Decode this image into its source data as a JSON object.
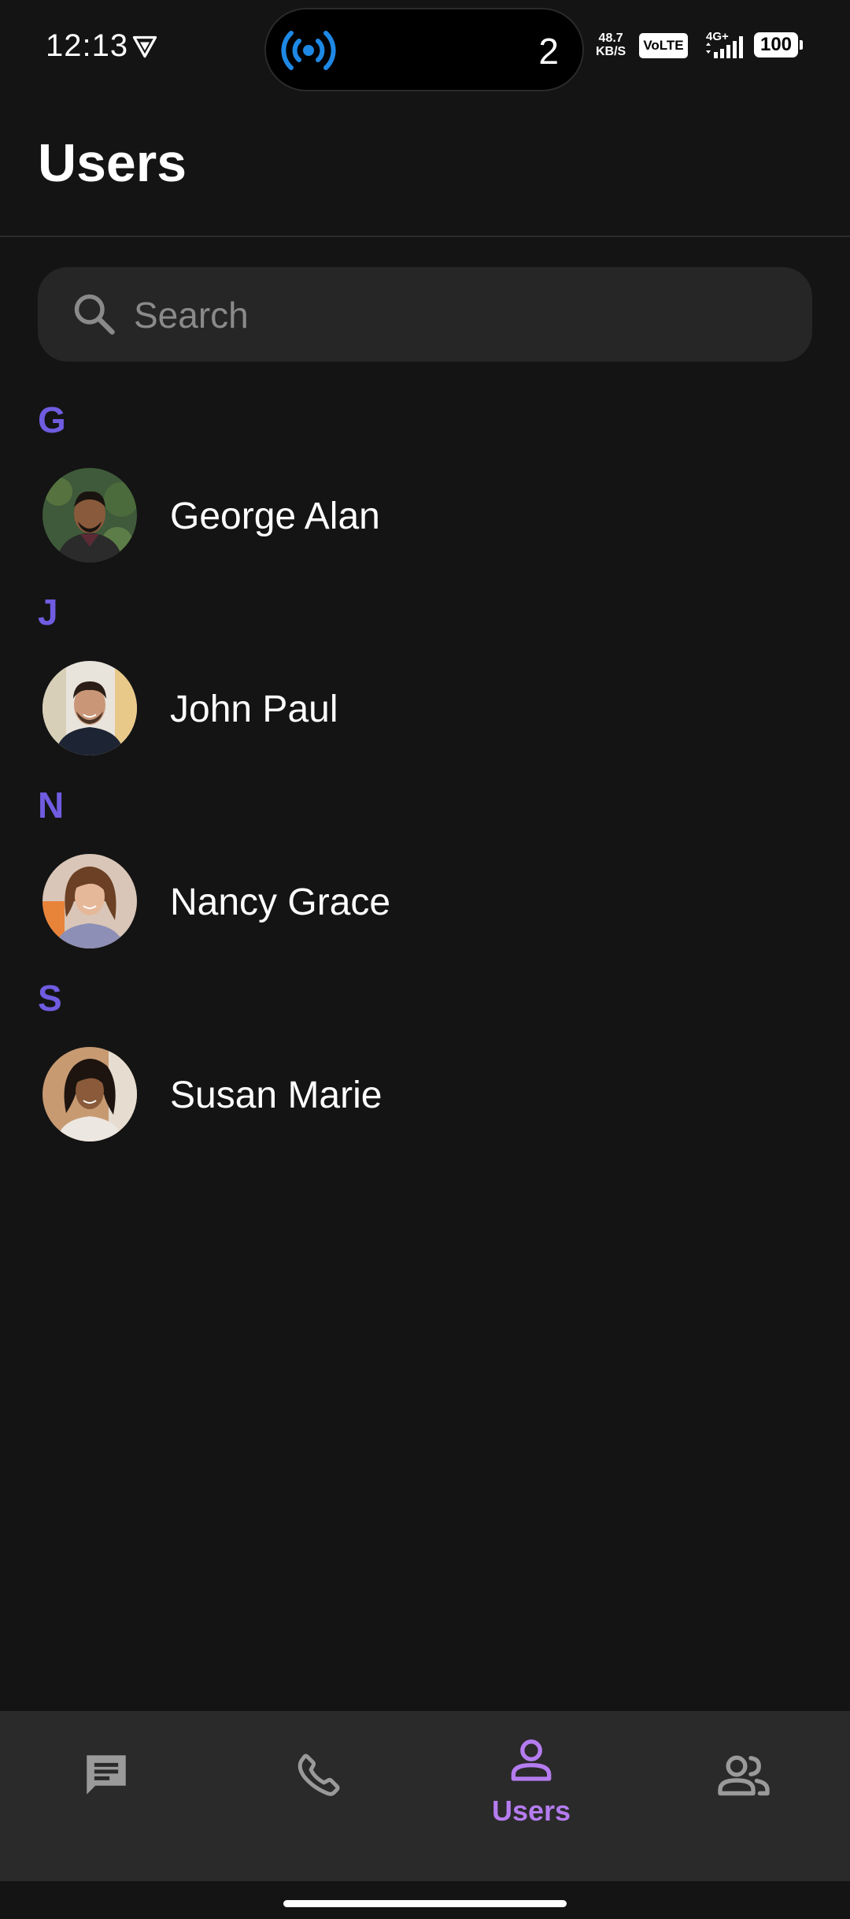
{
  "status_bar": {
    "time": "12:13",
    "island_count": "2",
    "speed_value": "48.7",
    "speed_unit": "KB/S",
    "volte": "VoLTE",
    "network": "4G+",
    "battery": "100"
  },
  "header": {
    "title": "Users"
  },
  "search": {
    "placeholder": "Search",
    "value": ""
  },
  "sections": [
    {
      "letter": "G",
      "contacts": [
        {
          "name": "George Alan"
        }
      ]
    },
    {
      "letter": "J",
      "contacts": [
        {
          "name": "John Paul"
        }
      ]
    },
    {
      "letter": "N",
      "contacts": [
        {
          "name": "Nancy Grace"
        }
      ]
    },
    {
      "letter": "S",
      "contacts": [
        {
          "name": "Susan Marie"
        }
      ]
    }
  ],
  "bottom_nav": {
    "items": [
      {
        "icon": "chat-icon",
        "label": ""
      },
      {
        "icon": "phone-icon",
        "label": ""
      },
      {
        "icon": "user-icon",
        "label": "Users",
        "active": true
      },
      {
        "icon": "group-icon",
        "label": ""
      }
    ]
  },
  "colors": {
    "background": "#141414",
    "accent_letter": "#6f5ce0",
    "accent_active": "#b57cf0",
    "nav_background": "#2a2a2a",
    "search_background": "#262626",
    "island_icon": "#1e88e5"
  }
}
